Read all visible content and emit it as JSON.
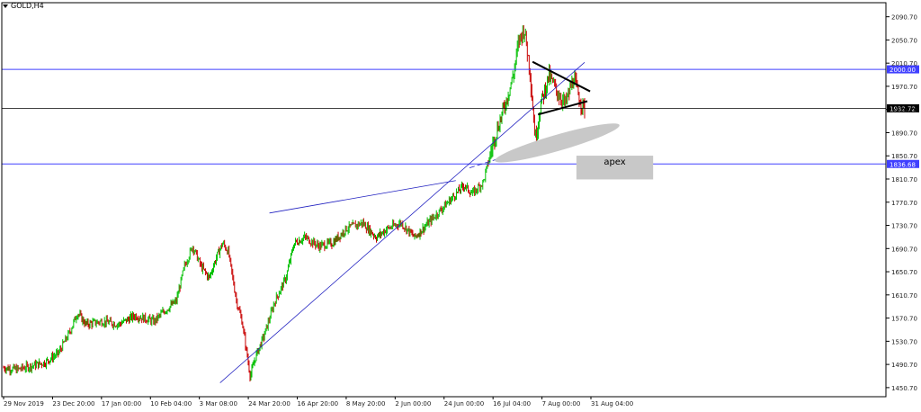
{
  "header": {
    "symbol_label": "GOLD,H4"
  },
  "colors": {
    "bull": "#00c000",
    "bear": "#c80000",
    "level_line": "#4040ff",
    "price_line": "#000000",
    "trend_line": "#2020c0",
    "annotation_gray": "#c8c8c8",
    "price_tag_fill": "#4040ff",
    "grid_text": "#202020"
  },
  "chart_data": {
    "type": "candlestick",
    "symbol": "GOLD",
    "timeframe": "H4",
    "ylim": [
      1435,
      2115
    ],
    "y_ticks": [
      "2090.70",
      "2050.70",
      "2010.70",
      "1970.70",
      "1930.70",
      "1890.70",
      "1850.70",
      "1810.70",
      "1770.70",
      "1730.70",
      "1690.70",
      "1650.70",
      "1610.70",
      "1570.70",
      "1530.70",
      "1490.70",
      "1450.70"
    ],
    "x_ticks": [
      "29 Nov 2019",
      "23 Dec 20:00",
      "17 Jan 00:00",
      "10 Feb 04:00",
      "3 Mar 08:00",
      "24 Mar 20:00",
      "16 Apr 20:00",
      "8 May 20:00",
      "2 Jun 00:00",
      "24 Jun 00:00",
      "16 Jul 04:00",
      "7 Aug 00:00",
      "31 Aug 04:00"
    ],
    "price_path": [
      [
        0,
        1485
      ],
      [
        5,
        1482
      ],
      [
        10,
        1488
      ],
      [
        15,
        1494
      ],
      [
        20,
        1510
      ],
      [
        24,
        1545
      ],
      [
        27,
        1580
      ],
      [
        30,
        1560
      ],
      [
        36,
        1565
      ],
      [
        42,
        1560
      ],
      [
        48,
        1575
      ],
      [
        55,
        1565
      ],
      [
        58,
        1580
      ],
      [
        63,
        1600
      ],
      [
        66,
        1660
      ],
      [
        69,
        1695
      ],
      [
        72,
        1660
      ],
      [
        75,
        1640
      ],
      [
        78,
        1680
      ],
      [
        80,
        1700
      ],
      [
        82,
        1685
      ],
      [
        85,
        1600
      ],
      [
        87,
        1565
      ],
      [
        90,
        1470
      ],
      [
        92,
        1505
      ],
      [
        95,
        1540
      ],
      [
        99,
        1600
      ],
      [
        103,
        1640
      ],
      [
        106,
        1700
      ],
      [
        110,
        1710
      ],
      [
        115,
        1695
      ],
      [
        120,
        1700
      ],
      [
        125,
        1725
      ],
      [
        131,
        1735
      ],
      [
        136,
        1710
      ],
      [
        140,
        1725
      ],
      [
        145,
        1735
      ],
      [
        150,
        1710
      ],
      [
        154,
        1730
      ],
      [
        158,
        1750
      ],
      [
        163,
        1775
      ],
      [
        168,
        1800
      ],
      [
        171,
        1785
      ],
      [
        175,
        1805
      ],
      [
        179,
        1880
      ],
      [
        183,
        1940
      ],
      [
        186,
        1990
      ],
      [
        188,
        2050
      ],
      [
        190,
        2070
      ],
      [
        192,
        2000
      ],
      [
        194,
        1880
      ],
      [
        196,
        1940
      ],
      [
        199,
        1990
      ],
      [
        202,
        1960
      ],
      [
        205,
        1940
      ],
      [
        208,
        1985
      ],
      [
        210,
        1950
      ],
      [
        212,
        1930
      ]
    ],
    "path_x_max": 212,
    "horizontal_levels": [
      {
        "value": 2000.0,
        "label": "2000.00"
      },
      {
        "value": 1836.68,
        "label": "1836.68"
      }
    ],
    "current_price": {
      "value": 1932.72,
      "label": "1932.72"
    },
    "annotations": [
      {
        "type": "text-box",
        "text": "apex"
      }
    ]
  }
}
